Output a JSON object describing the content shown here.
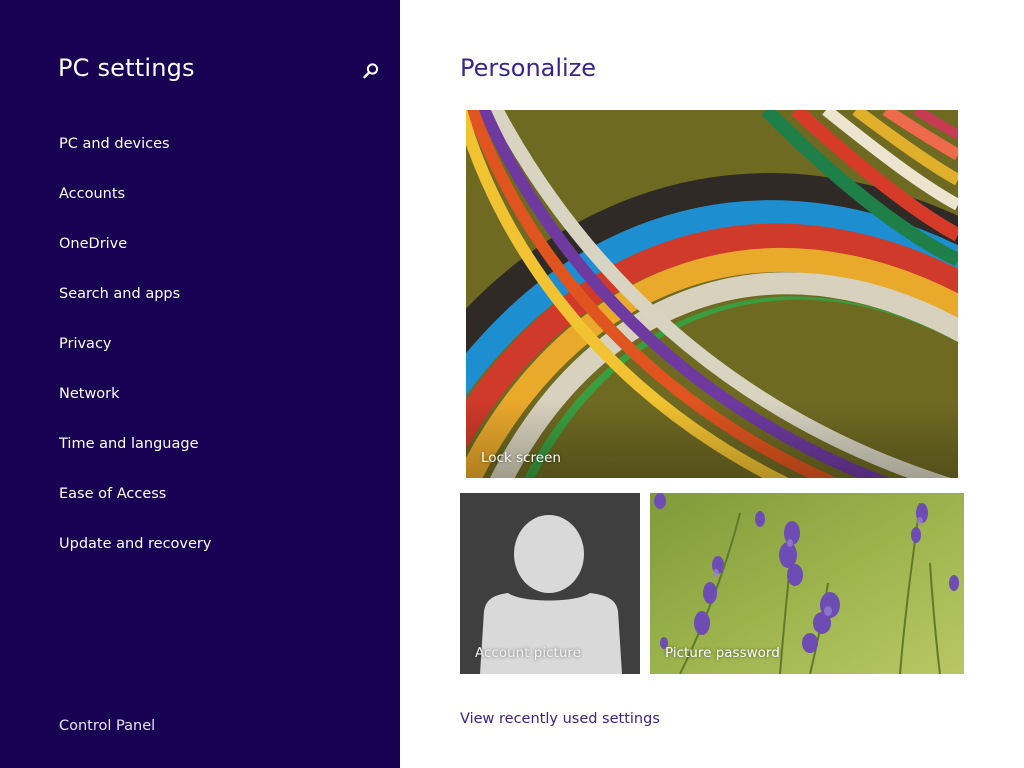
{
  "sidebar": {
    "title": "PC settings",
    "search_icon": "search-icon",
    "items": [
      {
        "label": "PC and devices"
      },
      {
        "label": "Accounts"
      },
      {
        "label": "OneDrive"
      },
      {
        "label": "Search and apps"
      },
      {
        "label": "Privacy"
      },
      {
        "label": "Network"
      },
      {
        "label": "Time and language"
      },
      {
        "label": "Ease of Access"
      },
      {
        "label": "Update and recovery"
      }
    ],
    "control_panel": "Control Panel"
  },
  "main": {
    "title": "Personalize",
    "tiles": {
      "lock_screen": "Lock screen",
      "account_picture": "Account picture",
      "picture_password": "Picture password"
    },
    "recent_link": "View recently used settings"
  },
  "colors": {
    "sidebar_bg": "#180052",
    "accent_text": "#3b2391",
    "account_tile_bg": "#3f3f3f"
  }
}
